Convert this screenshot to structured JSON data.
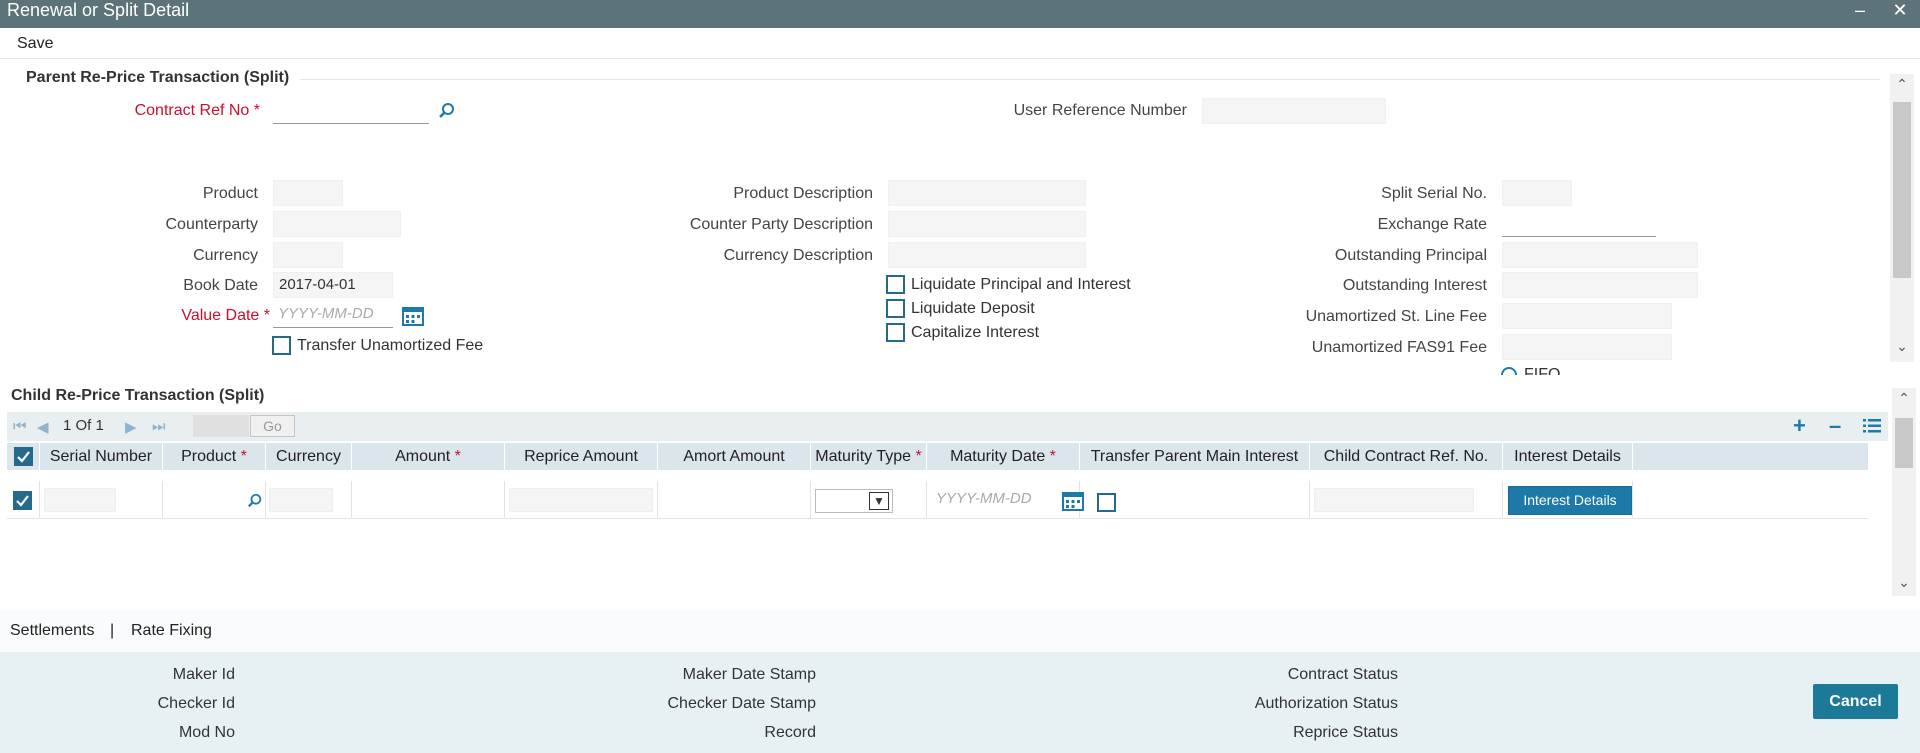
{
  "window": {
    "title": "Renewal or Split Detail",
    "minimize_icon": "minimize-icon",
    "close_icon": "close-icon"
  },
  "toolbar": {
    "save_label": "Save"
  },
  "parent": {
    "section_title": "Parent Re-Price Transaction (Split)",
    "contract_ref_no": {
      "label": "Contract Ref No",
      "required_mark": "*",
      "value": ""
    },
    "user_reference_number": {
      "label": "User Reference Number",
      "value": ""
    },
    "product": {
      "label": "Product",
      "value": ""
    },
    "counterparty": {
      "label": "Counterparty",
      "value": ""
    },
    "currency": {
      "label": "Currency",
      "value": ""
    },
    "book_date": {
      "label": "Book Date",
      "value": "2017-04-01"
    },
    "value_date": {
      "label": "Value Date",
      "required_mark": "*",
      "placeholder": "YYYY-MM-DD"
    },
    "transfer_unamortized_fee": {
      "label": "Transfer Unamortized Fee",
      "checked": false
    },
    "product_description": {
      "label": "Product Description",
      "value": ""
    },
    "counter_party_description": {
      "label": "Counter Party Description",
      "value": ""
    },
    "currency_description": {
      "label": "Currency Description",
      "value": ""
    },
    "liquidate_principal_and_interest": {
      "label": "Liquidate Principal and Interest",
      "checked": false
    },
    "liquidate_deposit": {
      "label": "Liquidate Deposit",
      "checked": false
    },
    "capitalize_interest": {
      "label": "Capitalize Interest",
      "checked": false
    },
    "split_serial_no": {
      "label": "Split Serial No.",
      "value": ""
    },
    "exchange_rate": {
      "label": "Exchange Rate",
      "value": ""
    },
    "outstanding_principal": {
      "label": "Outstanding Principal",
      "value": ""
    },
    "outstanding_interest": {
      "label": "Outstanding Interest",
      "value": ""
    },
    "unamortized_st_line_fee": {
      "label": "Unamortized St. Line Fee",
      "value": ""
    },
    "unamortized_fas91_fee": {
      "label": "Unamortized FAS91 Fee",
      "value": ""
    },
    "fifo_label": "FIFO"
  },
  "child": {
    "section_title": "Child Re-Price Transaction (Split)",
    "pager": {
      "current": "1",
      "of_label": "Of",
      "total": "1",
      "go_label": "Go"
    },
    "columns": [
      {
        "label": "Serial Number",
        "required": false
      },
      {
        "label": "Product",
        "required": true
      },
      {
        "label": "Currency",
        "required": false
      },
      {
        "label": "Amount",
        "required": true
      },
      {
        "label": "Reprice Amount",
        "required": false
      },
      {
        "label": "Amort Amount",
        "required": false
      },
      {
        "label": "Maturity Type",
        "required": true
      },
      {
        "label": "Maturity Date",
        "required": true
      },
      {
        "label": "Transfer Parent Main Interest",
        "required": false
      },
      {
        "label": "Child Contract Ref. No.",
        "required": false
      },
      {
        "label": "Interest Details",
        "required": false
      }
    ],
    "required_mark": "*",
    "row": {
      "maturity_date_placeholder": "YYYY-MM-DD",
      "interest_details_button": "Interest Details"
    }
  },
  "links": {
    "settlements": "Settlements",
    "separator": "|",
    "rate_fixing": "Rate Fixing"
  },
  "footer": {
    "maker_id": "Maker Id",
    "checker_id": "Checker Id",
    "mod_no": "Mod No",
    "maker_date_stamp": "Maker Date Stamp",
    "checker_date_stamp": "Checker Date Stamp",
    "record": "Record",
    "contract_status": "Contract Status",
    "authorization_status": "Authorization Status",
    "reprice_status": "Reprice Status",
    "cancel_label": "Cancel"
  },
  "colors": {
    "titlebar": "#5c7379",
    "accent": "#1d7aa8",
    "required": "#c8102e",
    "footer": "#e7f1f4"
  }
}
